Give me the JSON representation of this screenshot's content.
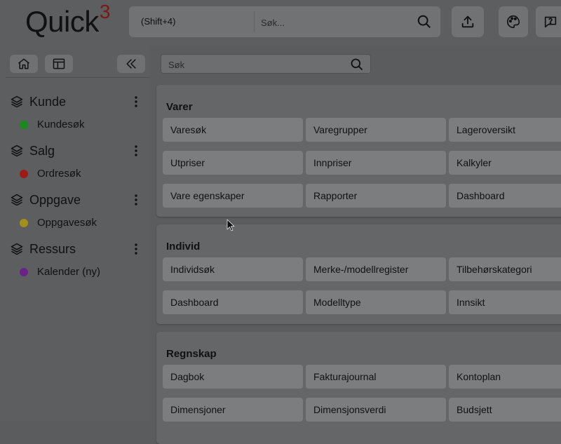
{
  "header": {
    "logo_text": "Quick",
    "logo_super": "3",
    "search_shortcut": "(Shift+4)",
    "search_placeholder": "Søk...",
    "buttons": [
      {
        "icon": "upload-icon"
      },
      {
        "icon": "palette-icon"
      },
      {
        "icon": "help-icon"
      }
    ]
  },
  "sidebar": {
    "toolbar": [
      {
        "icon": "home-icon"
      },
      {
        "icon": "layout-icon"
      },
      {
        "icon": "collapse-icon"
      }
    ],
    "sections": [
      {
        "label": "Kunde",
        "sub_label": "Kundesøk",
        "sub_color": "#1a8a1a"
      },
      {
        "label": "Salg",
        "sub_label": "Ordresøk",
        "sub_color": "#a01a14"
      },
      {
        "label": "Oppgave",
        "sub_label": "Oppgavesøk",
        "sub_color": "#a39018"
      },
      {
        "label": "Ressurs",
        "sub_label": "Kalender (ny)",
        "sub_color": "#6a2288"
      }
    ]
  },
  "main": {
    "search_placeholder": "Søk",
    "cards": [
      {
        "title": "Varer",
        "tiles": [
          "Varesøk",
          "Varegrupper",
          "Lageroversikt",
          "Utpriser",
          "Innpriser",
          "Kalkyler",
          "Vare egenskaper",
          "Rapporter",
          "Dashboard"
        ]
      },
      {
        "title": "Individ",
        "tiles": [
          "Individsøk",
          "Merke-/modellregister",
          "Tilbehørskategori",
          "Dashboard",
          "Modelltype",
          "Innsikt"
        ]
      },
      {
        "title": "Regnskap",
        "tiles": [
          "Dagbok",
          "Fakturajournal",
          "Kontoplan",
          "Dimensjoner",
          "Dimensjonsverdi",
          "Budsjett"
        ]
      }
    ]
  },
  "colors": {
    "overlay_bg": "#5a5c5e",
    "tile_bg": "#7b7d7f",
    "logo_accent": "#7a1a14"
  }
}
